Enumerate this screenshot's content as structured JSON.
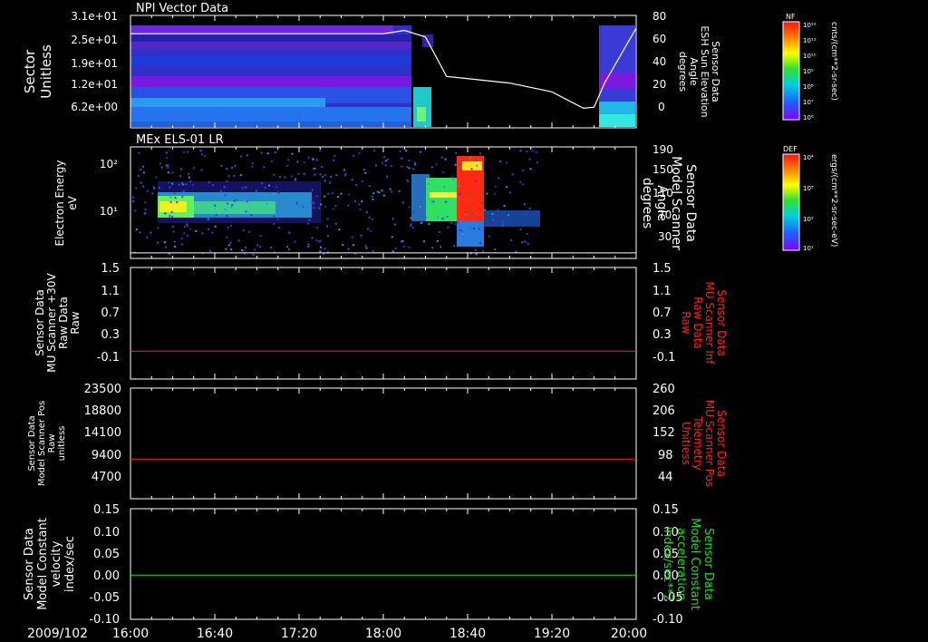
{
  "date_label": "2009/102",
  "time_ticks": [
    "16:00",
    "16:40",
    "17:20",
    "18:00",
    "18:40",
    "19:20",
    "20:00"
  ],
  "colors": {
    "white": "#ffffff",
    "red": "#ff2020",
    "green": "#22dd22",
    "black": "#000000"
  },
  "chart_data": [
    {
      "type": "heatmap",
      "title": "NPI Vector Data",
      "ylabel": [
        "Sector",
        "Unitless"
      ],
      "y_ticks": [
        "3.1e+01",
        "2.5e+01",
        "1.9e+01",
        "1.2e+01",
        "6.2e+00"
      ],
      "right_axis": {
        "label": [
          "Sensor Data",
          "ESH Sun Elevation",
          "Angle",
          "degrees"
        ],
        "ticks": [
          "80",
          "60",
          "40",
          "20",
          "0"
        ],
        "ylim": [
          -20,
          80
        ]
      },
      "overlay_line": {
        "name": "ESH Sun Elevation Angle",
        "x": [
          "16:00",
          "18:00",
          "18:10",
          "18:20",
          "18:30",
          "19:00",
          "19:20",
          "19:35",
          "19:40",
          "19:45",
          "20:00"
        ],
        "y": [
          65,
          65,
          68,
          62,
          26,
          20,
          12,
          -3,
          -2,
          20,
          70
        ]
      },
      "colorbar": {
        "label": "cnts/(cm**2-sr-sec)",
        "name": "NF",
        "ticks": [
          "10¹²",
          "10¹¹",
          "10¹⁰",
          "10⁹",
          "10⁸",
          "10⁷",
          "10⁶"
        ]
      }
    },
    {
      "type": "heatmap",
      "title": "MEx ELS-01 LR",
      "ylabel": [
        "Electron Energy",
        "eV"
      ],
      "y_ticks": [
        "10²",
        "10¹"
      ],
      "right_axis": {
        "label": [
          "Sensor Data",
          "Model Scanner",
          "Angle",
          "degrees"
        ],
        "ticks": [
          "190",
          "150",
          "110",
          "70",
          "30"
        ],
        "ylim": [
          10,
          190
        ]
      },
      "overlay_line": {
        "name": "Model Scanner Angle",
        "x": [
          "16:00",
          "20:00"
        ],
        "y": [
          19,
          19
        ]
      },
      "colorbar": {
        "label": "ergs/(cm**2-sr-sec-eV)",
        "name": "DEF",
        "ticks": [
          "10⁴",
          "10³",
          "10²",
          "10¹"
        ]
      }
    },
    {
      "type": "line",
      "ylabel": [
        "Sensor Data",
        "MU Scanner +30V",
        "Raw Data",
        "Raw"
      ],
      "y_ticks": [
        "1.5",
        "1.1",
        "0.7",
        "0.3",
        "-0.1"
      ],
      "ylim": [
        -0.5,
        1.5
      ],
      "right_axis": {
        "label": [
          "Sensor Data",
          "MU Scanner Inf",
          "Raw Data",
          "Raw"
        ],
        "ticks": [
          "1.5",
          "1.1",
          "0.7",
          "0.3",
          "-0.1"
        ],
        "ylim": [
          -0.5,
          1.5
        ]
      },
      "series": [
        {
          "name": "MU Scanner Inf Raw Data",
          "color": "#ff2020",
          "x": [
            "16:00",
            "20:00"
          ],
          "y": [
            0,
            0
          ]
        }
      ]
    },
    {
      "type": "line",
      "ylabel": [
        "Sensor Data",
        "Model Scanner Pos",
        "Raw",
        "unitless"
      ],
      "y_ticks": [
        "23500",
        "18800",
        "14100",
        "9400",
        "4700"
      ],
      "ylim": [
        0,
        23500
      ],
      "right_axis": {
        "label": [
          "Sensor Data",
          "MU Scanner Pos",
          "Telemetry",
          "Unitless"
        ],
        "ticks": [
          "260",
          "206",
          "152",
          "98",
          "44"
        ],
        "ylim": [
          -10,
          260
        ]
      },
      "series": [
        {
          "name": "MU Scanner Pos Telemetry",
          "color": "#ff2020",
          "axis": "right",
          "x": [
            "16:00",
            "20:00"
          ],
          "y": [
            87,
            87
          ]
        }
      ]
    },
    {
      "type": "line",
      "ylabel": [
        "Sensor Data",
        "Model Constant",
        "velocity",
        "index/sec"
      ],
      "y_ticks": [
        "0.15",
        "0.10",
        "0.05",
        "0.00",
        "-0.05",
        "-0.10"
      ],
      "ylim": [
        -0.1,
        0.15
      ],
      "right_axis": {
        "label": [
          "Sensor Data",
          "Model Constant",
          "acceleration",
          "index/sec**2"
        ],
        "ticks": [
          "0.15",
          "0.10",
          "0.05",
          "0.00",
          "-0.05",
          "-0.10"
        ],
        "ylim": [
          -0.1,
          0.15
        ]
      },
      "series": [
        {
          "name": "Model Constant acceleration",
          "color": "#22dd22",
          "axis": "right",
          "x": [
            "16:00",
            "20:00"
          ],
          "y": [
            0,
            0
          ]
        }
      ]
    }
  ]
}
